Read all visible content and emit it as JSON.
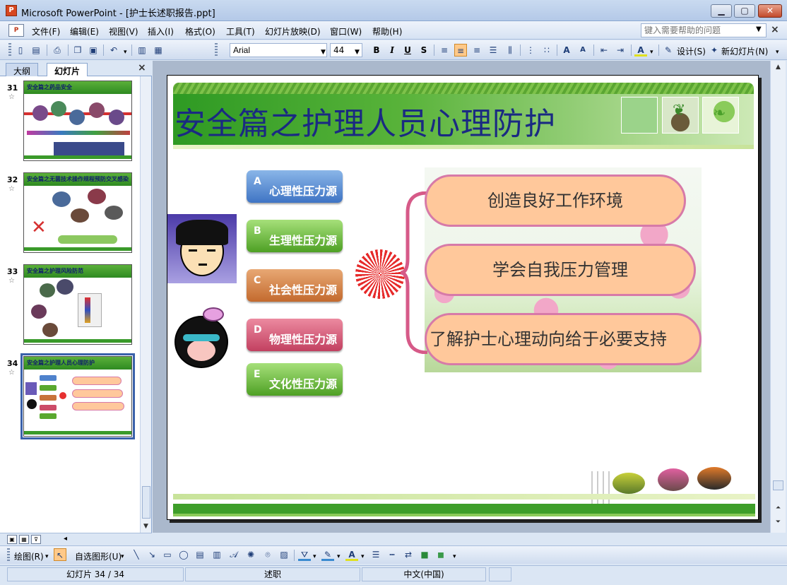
{
  "window": {
    "app_icon": "P",
    "title": "Microsoft PowerPoint - [护士长述职报告.ppt]",
    "minimize": "▁",
    "maximize": "▢",
    "close": "✕"
  },
  "menu": {
    "items": [
      "文件(F)",
      "编辑(E)",
      "视图(V)",
      "插入(I)",
      "格式(O)",
      "工具(T)",
      "幻灯片放映(D)",
      "窗口(W)",
      "帮助(H)"
    ],
    "help_placeholder": "键入需要帮助的问题",
    "close_glyph": "×"
  },
  "toolbar": {
    "font": "Arial",
    "size": "44",
    "bold": "B",
    "italic": "I",
    "underline": "U",
    "shadow": "S",
    "design": "设计(S)",
    "new_slide": "新幻灯片(N)"
  },
  "left_pane": {
    "tab_outline": "大纲",
    "tab_slides": "幻灯片",
    "close_glyph": "×",
    "thumbnails": [
      {
        "number": "31",
        "title": "安全篇之药品安全"
      },
      {
        "number": "32",
        "title": "安全篇之无菌技术操作规程预防交叉感染"
      },
      {
        "number": "33",
        "title": "安全篇之护理风险防范"
      },
      {
        "number": "34",
        "title": "安全篇之护理人员心理防护"
      }
    ],
    "selected": "34"
  },
  "slide": {
    "title": "安全篇之护理人员心理防护",
    "stress_sources": [
      {
        "letter": "A",
        "label": "心理性压力源",
        "color": "#3f74c4"
      },
      {
        "letter": "B",
        "label": "生理性压力源",
        "color": "#4ea024"
      },
      {
        "letter": "C",
        "label": "社会性压力源",
        "color": "#c36a2e"
      },
      {
        "letter": "D",
        "label": "物理性压力源",
        "color": "#c24060"
      },
      {
        "letter": "E",
        "label": "文化性压力源",
        "color": "#4ea024"
      }
    ],
    "actions": [
      "创造良好工作环境",
      "学会自我压力管理",
      "了解护士心理动向给于必要支持"
    ]
  },
  "drawbar": {
    "draw": "绘图(R)",
    "autoshapes": "自选图形(U)"
  },
  "status": {
    "slide_count": "幻灯片 34 / 34",
    "design_name": "述职",
    "language": "中文(中国)"
  }
}
